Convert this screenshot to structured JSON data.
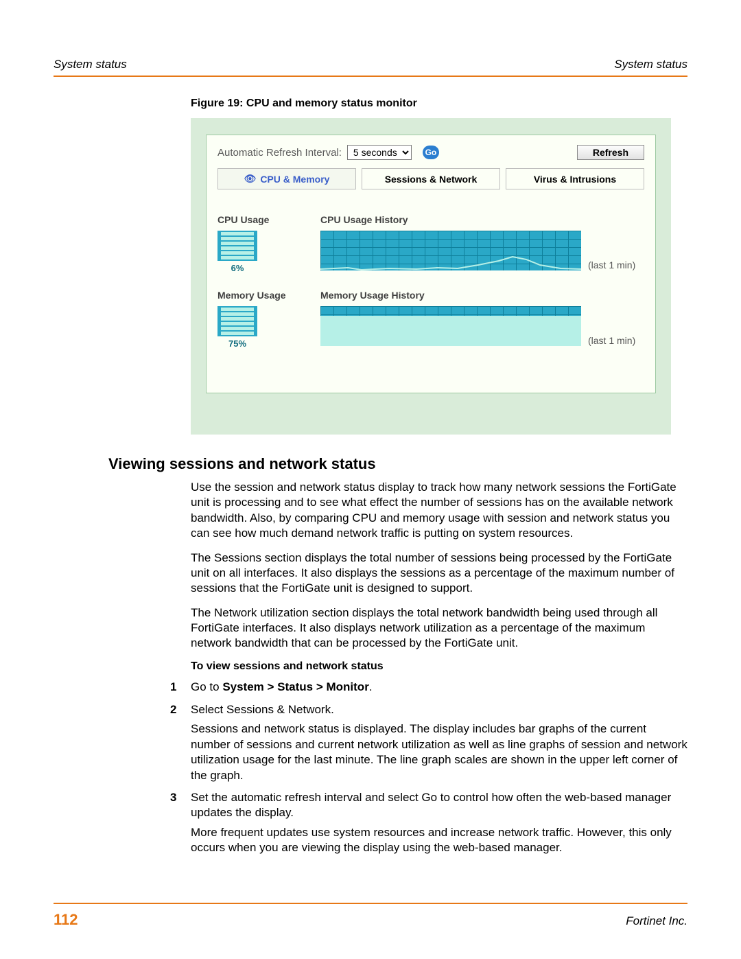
{
  "header": {
    "left": "System status",
    "right": "System status"
  },
  "figure": {
    "caption": "Figure 19: CPU and memory status monitor"
  },
  "monitor": {
    "refresh_label": "Automatic Refresh Interval:",
    "interval_value": "5 seconds",
    "go_label": "Go",
    "refresh_button": "Refresh",
    "tabs": {
      "cpu": "CPU & Memory",
      "sessions": "Sessions & Network",
      "virus": "Virus & Intrusions"
    },
    "cpu": {
      "title": "CPU Usage",
      "pct": "6%",
      "history_title": "CPU Usage History",
      "lastmin": "(last 1 min)"
    },
    "mem": {
      "title": "Memory Usage",
      "pct": "75%",
      "history_title": "Memory Usage History",
      "lastmin": "(last 1 min)"
    }
  },
  "section": {
    "heading": "Viewing sessions and network status",
    "p1": "Use the session and network status display to track how many network sessions the FortiGate unit is processing and to see what effect the number of sessions has on the available network bandwidth. Also, by comparing CPU and memory usage with session and network status you can see how much demand network traffic is putting on system resources.",
    "p2": "The Sessions section displays the total number of sessions being processed by the FortiGate unit on all interfaces. It also displays the sessions as a percentage of the maximum number of sessions that the FortiGate unit is designed to support.",
    "p3": "The Network utilization section displays the total network bandwidth being used through all FortiGate interfaces. It also displays network utilization as a percentage of the maximum network bandwidth that can be processed by the FortiGate unit.",
    "subheading": "To view sessions and network status",
    "steps": {
      "s1_pre": "Go to ",
      "s1_bold": "System > Status > Monitor",
      "s1_post": ".",
      "s2": "Select Sessions & Network.",
      "s2b": "Sessions and network status is displayed. The display includes bar graphs of the current number of sessions and current network utilization as well as line graphs of session and network utilization usage for the last minute. The line graph scales are shown in the upper left corner of the graph.",
      "s3": "Set the automatic refresh interval and select Go to control how often the web-based manager updates the display.",
      "s3b": "More frequent updates use system resources and increase network traffic. However, this only occurs when you are viewing the display using the web-based manager."
    }
  },
  "footer": {
    "page": "112",
    "company": "Fortinet Inc."
  }
}
